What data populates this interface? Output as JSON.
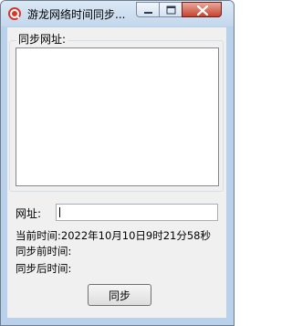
{
  "window": {
    "title": "游龙网络时间同步...",
    "icon": "app-logo-icon"
  },
  "titlebar_buttons": [
    "minimize-icon",
    "maximize-icon",
    "close-icon"
  ],
  "group": {
    "label": "同步网址:"
  },
  "url": {
    "label": "网址:",
    "value": ""
  },
  "info": {
    "current_time": "当前时间:2022年10月10日9时21分58秒",
    "before_sync": "同步前时间:",
    "after_sync": "同步后时间:"
  },
  "buttons": {
    "sync": "同步"
  },
  "colors": {
    "accent_close": "#c7432e",
    "titlebar": "#c3d7ec",
    "client_bg": "#f0f0f0"
  }
}
